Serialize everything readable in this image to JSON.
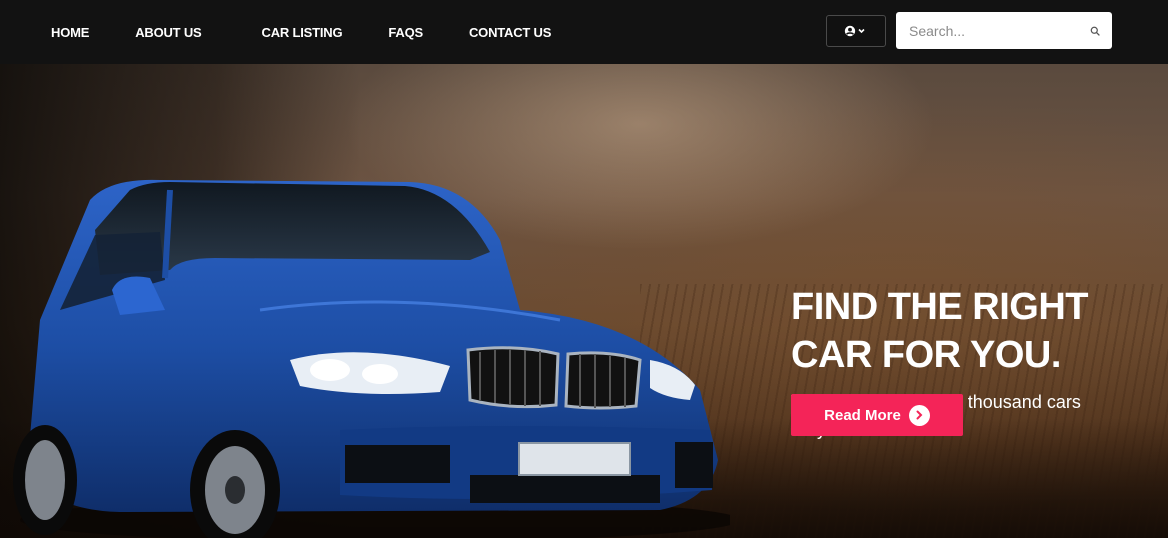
{
  "nav": {
    "items": [
      {
        "label": "HOME"
      },
      {
        "label": "ABOUT US"
      },
      {
        "label": "CAR LISTING"
      },
      {
        "label": "FAQS"
      },
      {
        "label": "CONTACT US"
      }
    ]
  },
  "tools": {
    "user_icon": "user-circle-icon",
    "search": {
      "placeholder": "Search...",
      "value": "",
      "icon": "search-icon"
    }
  },
  "hero": {
    "title_line1": "FIND THE RIGHT",
    "title_line2": "CAR FOR YOU.",
    "subtitle": "We have more than a thousand cars for you to choose.",
    "cta_label": "Read More",
    "cta_icon": "chevron-right-icon",
    "colors": {
      "cta": "#f42458",
      "topbar": "#121212",
      "car": "#1f4fa8"
    }
  }
}
